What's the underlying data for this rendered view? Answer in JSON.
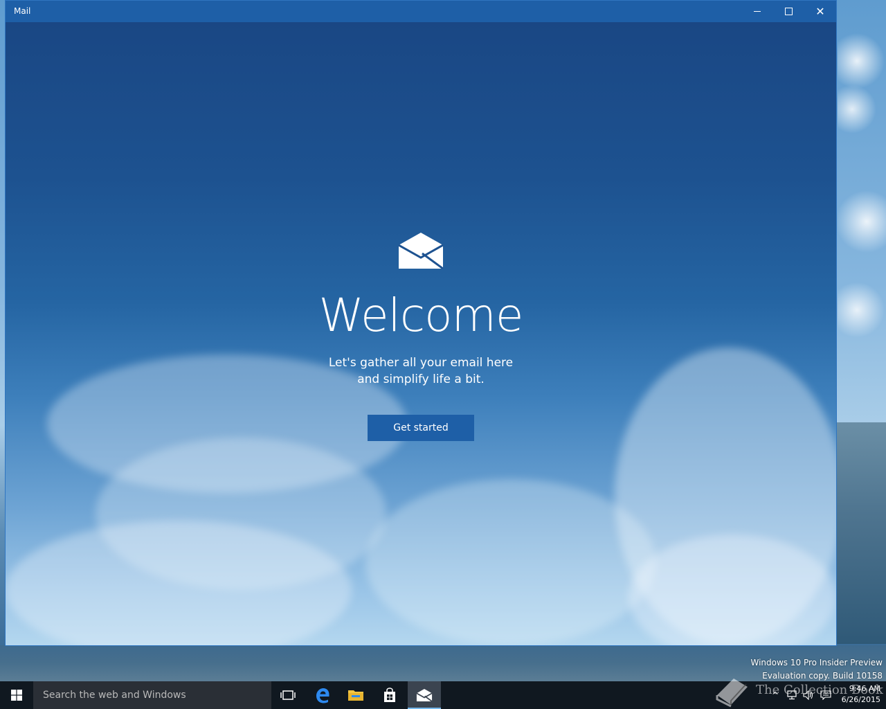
{
  "window": {
    "title": "Mail",
    "controls": {
      "minimize": "minimize-icon",
      "maximize": "maximize-icon",
      "close": "close-icon"
    }
  },
  "welcome": {
    "heading": "Welcome",
    "subtitle": "Let's gather all your email here and simplify life a bit.",
    "button_label": "Get started",
    "icon": "mail-icon"
  },
  "desktop": {
    "watermark_line1": "Windows 10 Pro Insider Preview",
    "watermark_line2": "Evaluation copy. Build 10158"
  },
  "taskbar": {
    "search_placeholder": "Search the web and Windows",
    "apps": [
      "task-view-icon",
      "edge-icon",
      "file-explorer-icon",
      "store-icon",
      "mail-icon"
    ],
    "time": "9:46 AM",
    "date": "6/26/2015",
    "brand_text": "The Collection Book"
  },
  "colors": {
    "accent": "#1e5fa7",
    "taskbar": "#101820",
    "search_bg": "#2a2f36"
  }
}
